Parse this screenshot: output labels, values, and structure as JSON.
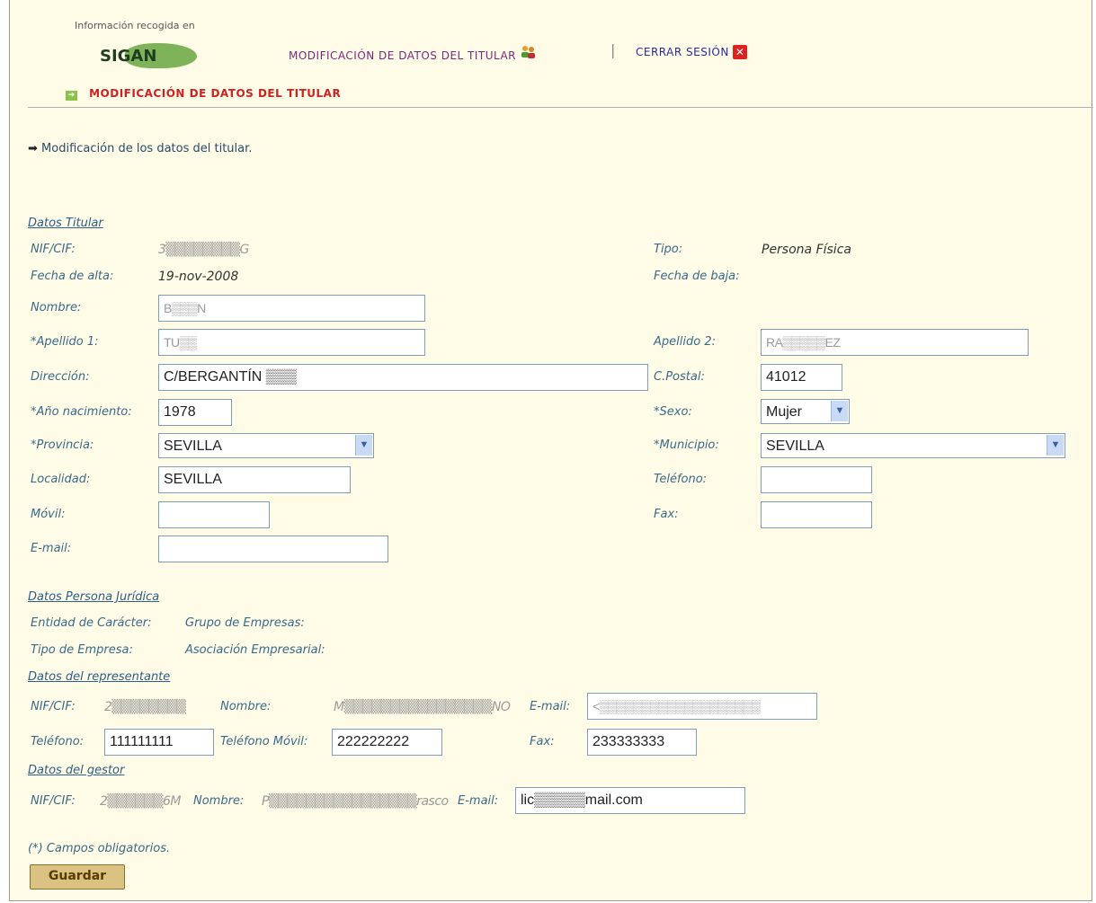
{
  "header": {
    "info_label": "Información recogida en",
    "logo_text": "SIGAN",
    "link_modify": "MODIFICACIÓN DE DATOS DEL TITULAR",
    "separator": "|",
    "link_logout": "CERRAR SESIÓN",
    "breadcrumb": "MODIFICACIÓN DE DATOS DEL TITULAR"
  },
  "intro": "Modificación de los datos del titular.",
  "titular": {
    "section": "Datos Titular",
    "nif_label": "NIF/CIF:",
    "nif_value": "3▒▒▒▒▒▒▒▒G",
    "tipo_label": "Tipo:",
    "tipo_value": "Persona Física",
    "fecha_alta_label": "Fecha de alta:",
    "fecha_alta_value": "19-nov-2008",
    "fecha_baja_label": "Fecha de baja:",
    "nombre_label": "Nombre:",
    "nombre_value": "B▒▒▒N",
    "apellido1_label": "*Apellido 1:",
    "apellido1_value": "TU▒▒",
    "apellido2_label": "Apellido 2:",
    "apellido2_value": "RA▒▒▒▒▒EZ",
    "direccion_label": "Dirección:",
    "direccion_value": "C/BERGANTÍN ▒▒▒",
    "cpostal_label": "C.Postal:",
    "cpostal_value": "41012",
    "anio_label": "*Año nacimiento:",
    "anio_value": "1978",
    "sexo_label": "*Sexo:",
    "sexo_value": "Mujer",
    "provincia_label": "*Provincia:",
    "provincia_value": "SEVILLA",
    "municipio_label": "*Municipio:",
    "municipio_value": "SEVILLA",
    "localidad_label": "Localidad:",
    "localidad_value": "SEVILLA",
    "telefono_label": "Teléfono:",
    "telefono_value": "",
    "movil_label": "Móvil:",
    "movil_value": "",
    "fax_label": "Fax:",
    "fax_value": "",
    "email_label": "E-mail:",
    "email_value": ""
  },
  "juridica": {
    "section": "Datos Persona Jurídica",
    "entidad_label": "Entidad de Carácter:",
    "grupo_label": "Grupo de Empresas:",
    "tipo_empresa_label": "Tipo de Empresa:",
    "asociacion_label": "Asociación Empresarial:"
  },
  "representante": {
    "section": "Datos del representante",
    "nif_label": "NIF/CIF:",
    "nif_value": "2▒▒▒▒▒▒▒▒",
    "nombre_label": "Nombre:",
    "nombre_value": "M▒▒▒▒▒▒▒▒▒▒▒▒▒▒▒▒NO",
    "email_label": "E-mail:",
    "email_value": "<▒▒▒▒▒▒▒▒▒▒▒▒▒▒▒▒▒▒▒",
    "telefono_label": "Teléfono:",
    "telefono_value": "111111111",
    "movil_label": "Teléfono Móvil:",
    "movil_value": "222222222",
    "fax_label": "Fax:",
    "fax_value": "233333333"
  },
  "gestor": {
    "section": "Datos del gestor",
    "nif_label": "NIF/CIF:",
    "nif_value": "2▒▒▒▒▒▒6M",
    "nombre_label": "Nombre:",
    "nombre_value": "P▒▒▒▒▒▒▒▒▒▒▒▒▒▒▒▒rasco",
    "email_label": "E-mail:",
    "email_value": "lic▒▒▒▒▒mail.com"
  },
  "footer": {
    "required_note": "(*) Campos obligatorios.",
    "save_button": "Guardar"
  },
  "colors": {
    "background": "#fefbe6",
    "link_purple": "#7a2a7a",
    "link_blue": "#2a2a9a",
    "breadcrumb_red": "#cc2222",
    "label_blue": "#3a6a8a",
    "button_gold": "#d9c282"
  },
  "icons": {
    "modify_link": "user-edit-icon",
    "logout_link": "close-icon",
    "breadcrumb": "arrow-box-icon",
    "intro": "right-arrow-icon"
  }
}
